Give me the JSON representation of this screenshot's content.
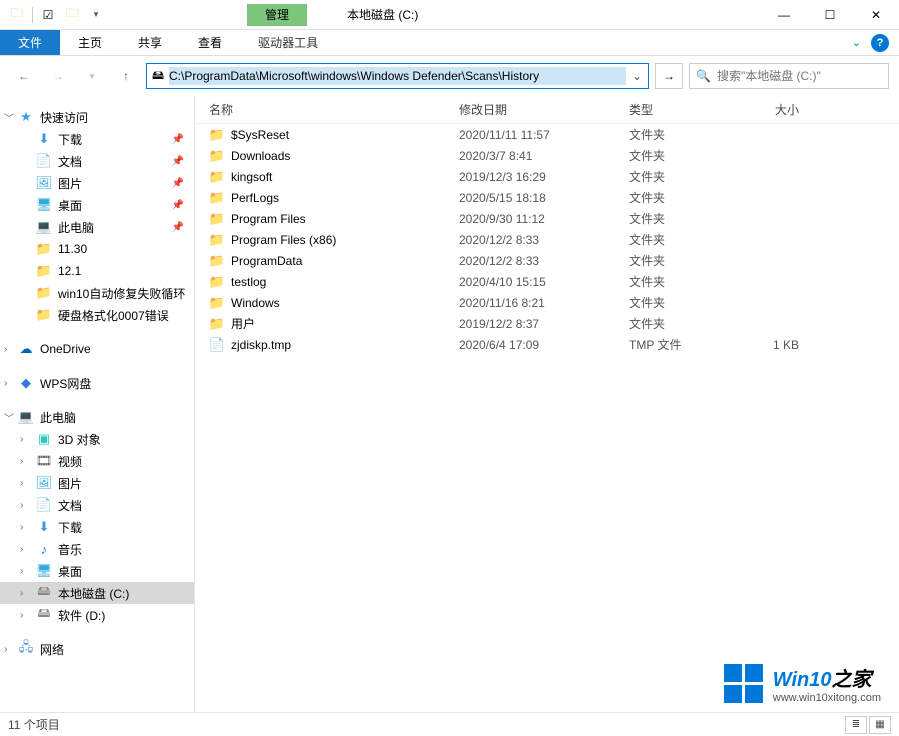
{
  "title_tab_manage": "管理",
  "window_title": "本地磁盘 (C:)",
  "ribbon": {
    "file": "文件",
    "home": "主页",
    "share": "共享",
    "view": "查看",
    "drive_tools": "驱动器工具"
  },
  "address_path": "C:\\ProgramData\\Microsoft\\windows\\Windows Defender\\Scans\\History",
  "search_placeholder": "搜索\"本地磁盘 (C:)\"",
  "sidebar": {
    "quick_access": "快速访问",
    "downloads": "下载",
    "documents": "文档",
    "pictures": "图片",
    "desktop": "桌面",
    "this_pc_q": "此电脑",
    "f_1130": "11.30",
    "f_121": "12.1",
    "f_win10": "win10自动修复失败循环",
    "f_hdd": "硬盘格式化0007错误",
    "onedrive": "OneDrive",
    "wps": "WPS网盘",
    "this_pc": "此电脑",
    "3d": "3D 对象",
    "video": "视频",
    "pictures2": "图片",
    "documents2": "文档",
    "downloads2": "下载",
    "music": "音乐",
    "desktop2": "桌面",
    "drive_c": "本地磁盘 (C:)",
    "drive_d": "软件 (D:)",
    "network": "网络"
  },
  "columns": {
    "name": "名称",
    "date": "修改日期",
    "type": "类型",
    "size": "大小"
  },
  "rows": [
    {
      "name": "$SysReset",
      "date": "2020/11/11 11:57",
      "type": "文件夹",
      "size": "",
      "icon": "folder"
    },
    {
      "name": "Downloads",
      "date": "2020/3/7 8:41",
      "type": "文件夹",
      "size": "",
      "icon": "folder"
    },
    {
      "name": "kingsoft",
      "date": "2019/12/3 16:29",
      "type": "文件夹",
      "size": "",
      "icon": "folder"
    },
    {
      "name": "PerfLogs",
      "date": "2020/5/15 18:18",
      "type": "文件夹",
      "size": "",
      "icon": "folder"
    },
    {
      "name": "Program Files",
      "date": "2020/9/30 11:12",
      "type": "文件夹",
      "size": "",
      "icon": "folder"
    },
    {
      "name": "Program Files (x86)",
      "date": "2020/12/2 8:33",
      "type": "文件夹",
      "size": "",
      "icon": "folder"
    },
    {
      "name": "ProgramData",
      "date": "2020/12/2 8:33",
      "type": "文件夹",
      "size": "",
      "icon": "folder"
    },
    {
      "name": "testlog",
      "date": "2020/4/10 15:15",
      "type": "文件夹",
      "size": "",
      "icon": "folder"
    },
    {
      "name": "Windows",
      "date": "2020/11/16 8:21",
      "type": "文件夹",
      "size": "",
      "icon": "folder"
    },
    {
      "name": "用户",
      "date": "2019/12/2 8:37",
      "type": "文件夹",
      "size": "",
      "icon": "folder"
    },
    {
      "name": "zjdiskp.tmp",
      "date": "2020/6/4 17:09",
      "type": "TMP 文件",
      "size": "1 KB",
      "icon": "file"
    }
  ],
  "status_text": "11 个项目",
  "watermark": {
    "line1a": "Win10",
    "line1b": "之家",
    "line2": "www.win10xitong.com"
  }
}
